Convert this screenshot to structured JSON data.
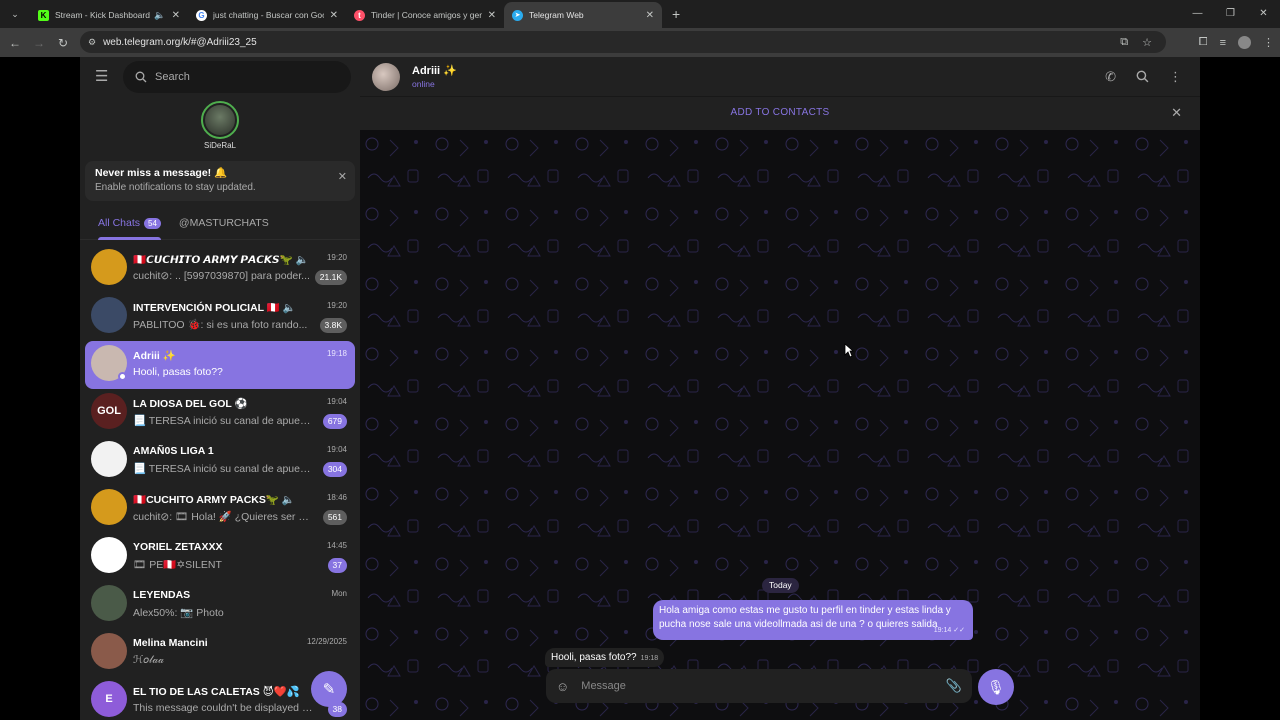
{
  "browser": {
    "tabs": [
      {
        "title": "Stream - Kick Dashboard",
        "favicon": "K",
        "favicon_color": "#53fc18",
        "audio": true,
        "active": false
      },
      {
        "title": "just chatting - Buscar con Google",
        "favicon": "G",
        "favicon_color": "#ffffff",
        "audio": false,
        "active": false
      },
      {
        "title": "Tinder | Conoce amigos y gente nueva",
        "favicon": "t",
        "favicon_color": "#fd5068",
        "audio": false,
        "active": false
      },
      {
        "title": "Telegram Web",
        "favicon": "➤",
        "favicon_color": "#2aabee",
        "audio": false,
        "active": true
      }
    ],
    "url": "web.telegram.org/k/#@Adriii23_25"
  },
  "sidebar": {
    "search_placeholder": "Search",
    "story_name": "SiDeRaL",
    "notification": {
      "title": "Never miss a message! 🔔",
      "text": "Enable notifications to stay updated."
    },
    "folders": [
      {
        "label": "All Chats",
        "badge": "54",
        "active": true
      },
      {
        "label": "@MASTURCHATS",
        "badge": "",
        "active": false
      }
    ],
    "chats": [
      {
        "name": "🇵🇪𝘾𝙐𝘾𝙃𝙄𝙏𝙊 𝘼𝙍𝙈𝙔 𝙋𝘼𝘾𝙆𝙎🦖 🔈",
        "time": "19:20",
        "preview": "cuchit⊘: .. [5997039870] para poder...",
        "badge": "21.1K",
        "badge_muted": true,
        "avatar_color": "#d59a1c",
        "avatar_text": "",
        "active": false
      },
      {
        "name": "INTERVENCIÓN POLICIAL 🇵🇪 🔈",
        "time": "19:20",
        "preview": "PABLITOO 🐞: si es una foto rando...",
        "badge": "3.8K",
        "badge_muted": true,
        "avatar_color": "#3b4a66",
        "avatar_text": "",
        "active": false
      },
      {
        "name": "Adriii ✨",
        "time": "19:18",
        "preview": "Hooli, pasas foto??",
        "badge": "",
        "badge_muted": false,
        "avatar_color": "#c9b8b0",
        "avatar_text": "",
        "active": true
      },
      {
        "name": "LA DIOSA DEL GOL ⚽",
        "time": "19:04",
        "preview": "📃 TERESA inició su canal de apuest...",
        "badge": "679",
        "badge_muted": false,
        "avatar_color": "#5a2020",
        "avatar_text": "GOL",
        "active": false
      },
      {
        "name": "AMAÑ0S LIGA 1",
        "time": "19:04",
        "preview": "📃 TERESA inició su canal de apuest...",
        "badge": "304",
        "badge_muted": false,
        "avatar_color": "#f2f2f2",
        "avatar_text": "",
        "active": false
      },
      {
        "name": "🇵🇪CUCHITO ARMY PACKS🦖 🔈",
        "time": "18:46",
        "preview": "cuchit⊘: 🎞 Hola! 🚀 ¿Quieres ser par...",
        "badge": "561",
        "badge_muted": true,
        "avatar_color": "#d59a1c",
        "avatar_text": "",
        "active": false
      },
      {
        "name": "YORIEL ZETAXXX",
        "time": "14:45",
        "preview": "🎞 PE🇵🇪✡SILENT",
        "badge": "37",
        "badge_muted": false,
        "avatar_color": "#ffffff",
        "avatar_text": "",
        "active": false
      },
      {
        "name": "LEYENDAS",
        "time": "Mon",
        "preview": "Alex50%: 📷 Photo",
        "badge": "",
        "badge_muted": false,
        "avatar_color": "#4a5a48",
        "avatar_text": "",
        "active": false
      },
      {
        "name": "Melina Mancini",
        "time": "12/29/2025",
        "preview": "ℋ𝑜𝓁𝒶𝒶",
        "badge": "",
        "badge_muted": false,
        "avatar_color": "#8a5a4a",
        "avatar_text": "",
        "active": false
      },
      {
        "name": "EL TIO DE LAS CALETAS 😈❤️💦",
        "time": "",
        "preview": "This message couldn't be displayed o...",
        "badge": "38",
        "badge_muted": false,
        "avatar_color": "#8e5cd9",
        "avatar_text": "E",
        "active": false
      }
    ]
  },
  "chat": {
    "name": "Adriii ✨",
    "status": "online",
    "add_to_contacts": "ADD TO CONTACTS",
    "date_chip": "Today",
    "outgoing": {
      "text": "Hola amiga como estas me gusto tu perfil en tinder y estas linda y pucha nose sale una videollmada asi de una ? o quieres salida",
      "time": "19:14"
    },
    "incoming": {
      "text": "Hooli, pasas foto??",
      "time": "19:18"
    },
    "composer_placeholder": "Message"
  },
  "colors": {
    "accent": "#8774e1",
    "panel": "#212121",
    "background": "#0e0e10"
  }
}
